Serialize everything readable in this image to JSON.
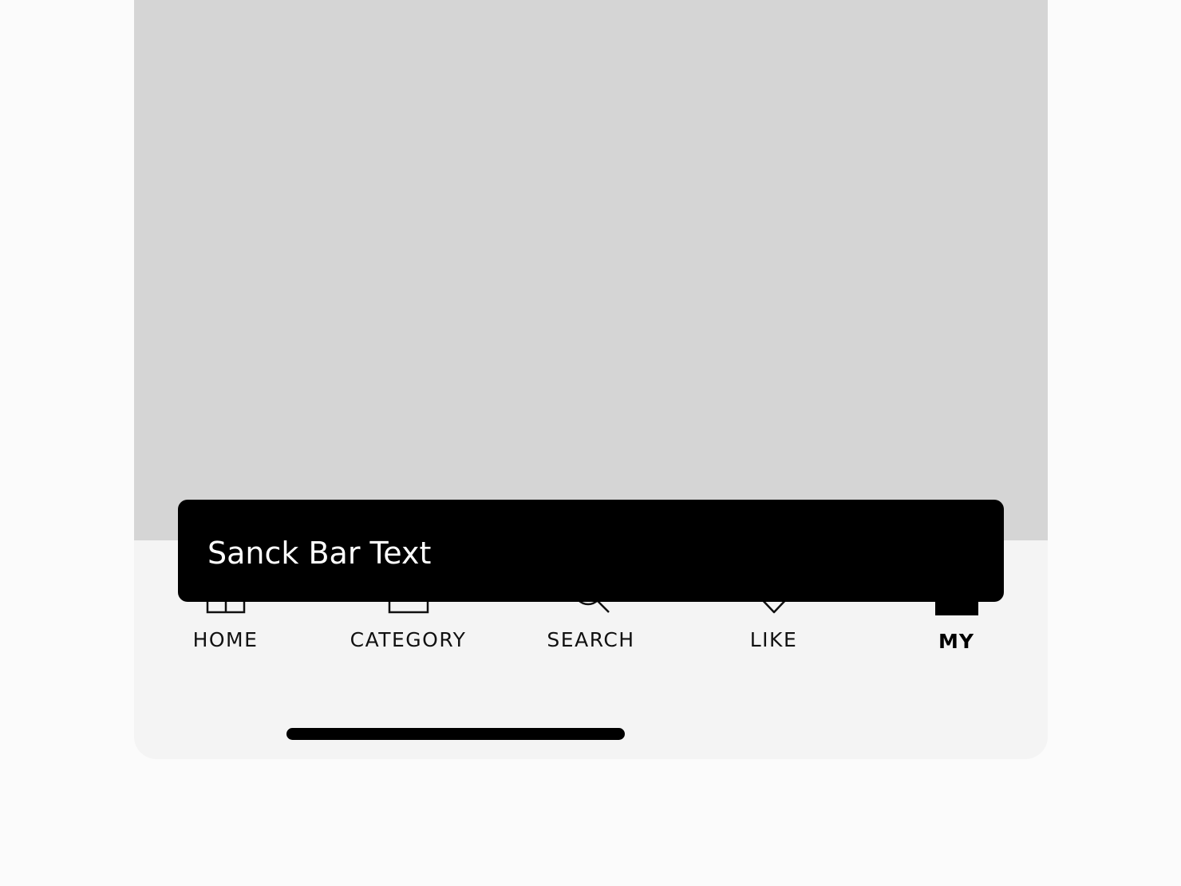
{
  "tab_bar": {
    "items": [
      {
        "label": "HOME",
        "icon": "home-icon",
        "active": false
      },
      {
        "label": "CATEGORY",
        "icon": "category-icon",
        "active": false
      },
      {
        "label": "SEARCH",
        "icon": "search-icon",
        "active": false
      },
      {
        "label": "LIKE",
        "icon": "heart-icon",
        "active": false
      },
      {
        "label": "MY",
        "icon": "profile-icon",
        "active": true
      }
    ]
  },
  "snackbar": {
    "text": "Sanck Bar Text"
  },
  "colors": {
    "page_background": "#fbfbfb",
    "screen_background": "#f4f4f4",
    "content_placeholder": "#d5d5d5",
    "snackbar_background": "#000000",
    "snackbar_text": "#ffffff",
    "tab_text": "#111111"
  }
}
